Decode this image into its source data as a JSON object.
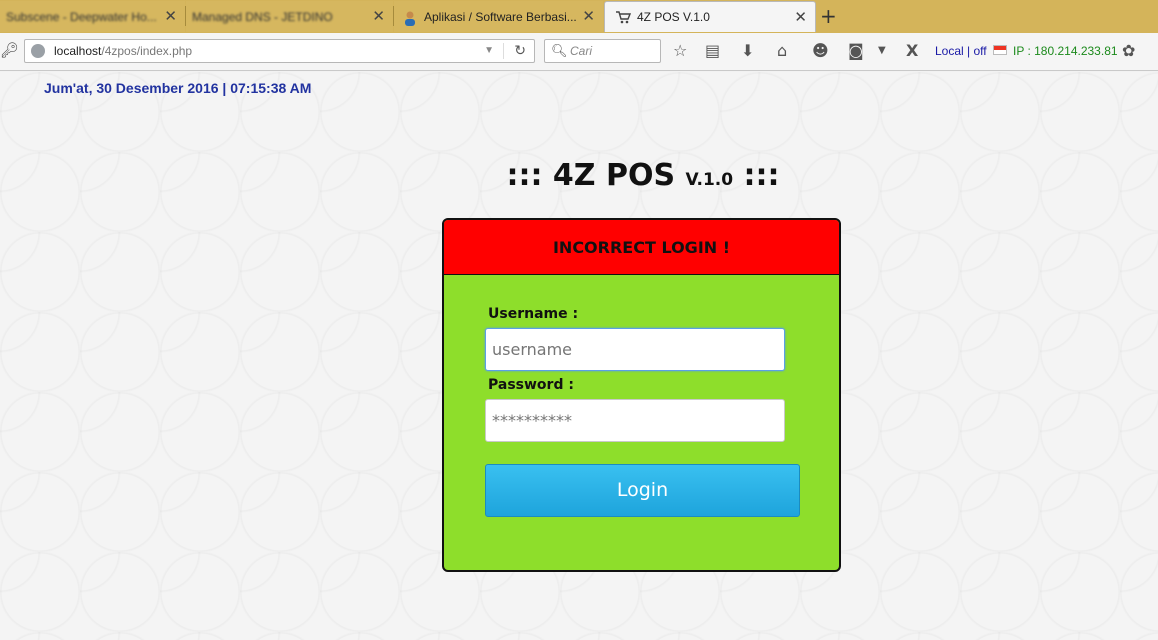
{
  "browser": {
    "tabs": [
      {
        "label": "Subscene - Deepwater Ho..."
      },
      {
        "label": "Managed DNS - JETDINO"
      },
      {
        "label": "Aplikasi / Software Berbasi..."
      },
      {
        "label": "4Z POS V.1.0"
      }
    ],
    "address": {
      "host": "localhost",
      "path": "/4zpos/index.php"
    },
    "search_placeholder": "Cari",
    "local_status": "Local | off",
    "ip": "IP : 180.214.233.81"
  },
  "page": {
    "datetime": "Jum'at, 30 Desember 2016 | 07:15:38 AM",
    "title": "::: 4Z POS",
    "version": "V.1.0",
    "title_suffix": ":::"
  },
  "login": {
    "error_message": "INCORRECT LOGIN !",
    "username_label": "Username :",
    "username_placeholder": "username",
    "password_label": "Password :",
    "password_placeholder": "**********",
    "submit_label": "Login"
  },
  "colors": {
    "error_bg": "#ff0000",
    "form_bg": "#8ede2b",
    "button": "#29b4e8",
    "datetime_text": "#2233a0"
  }
}
